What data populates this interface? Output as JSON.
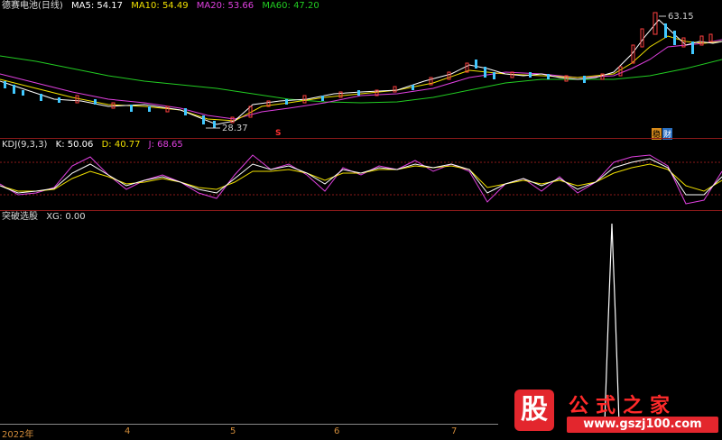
{
  "main": {
    "title": "德赛电池(日线)",
    "ma": [
      {
        "label": "MA5: 54.17",
        "color": "#ffffff"
      },
      {
        "label": "MA10: 54.49",
        "color": "#f0e000"
      },
      {
        "label": "MA20: 53.66",
        "color": "#e040e0"
      },
      {
        "label": "MA60: 47.20",
        "color": "#22cc22"
      }
    ],
    "high_label": "63.15",
    "low_label": "28.37",
    "s_marker": "S",
    "fin_badge_1": "稳",
    "fin_badge_2": "财"
  },
  "kdj": {
    "title": "KDJ(9,3,3)",
    "k": "K: 50.06",
    "d": "D: 40.77",
    "j": "J: 68.65",
    "colors": {
      "k": "#ffffff",
      "d": "#f0e000",
      "j": "#e040e0"
    }
  },
  "signal": {
    "title": "突破选股",
    "xg": "XG: 0.00"
  },
  "xaxis": {
    "labels": [
      "2022年",
      "4",
      "5",
      "6",
      "7"
    ]
  },
  "watermark": {
    "char": "股",
    "name": "公式之家",
    "url": "www.gszj100.com"
  }
}
